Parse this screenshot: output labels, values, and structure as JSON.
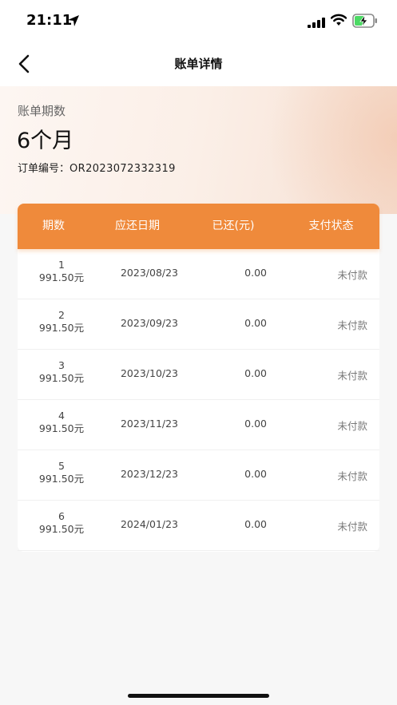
{
  "status_bar": {
    "time": "21:11"
  },
  "nav": {
    "title": "账单详情"
  },
  "summary": {
    "period_label": "账单期数",
    "period_value": "6个月",
    "order_label": "订单编号：",
    "order_number": "OR2023072332319"
  },
  "table": {
    "header_color": "#ef8a3b",
    "headers": [
      "期数",
      "应还日期",
      "已还(元)",
      "支付状态"
    ],
    "rows": [
      {
        "no": "1",
        "amount": "991.50元",
        "date": "2023/08/23",
        "paid": "0.00",
        "status": "未付款"
      },
      {
        "no": "2",
        "amount": "991.50元",
        "date": "2023/09/23",
        "paid": "0.00",
        "status": "未付款"
      },
      {
        "no": "3",
        "amount": "991.50元",
        "date": "2023/10/23",
        "paid": "0.00",
        "status": "未付款"
      },
      {
        "no": "4",
        "amount": "991.50元",
        "date": "2023/11/23",
        "paid": "0.00",
        "status": "未付款"
      },
      {
        "no": "5",
        "amount": "991.50元",
        "date": "2023/12/23",
        "paid": "0.00",
        "status": "未付款"
      },
      {
        "no": "6",
        "amount": "991.50元",
        "date": "2024/01/23",
        "paid": "0.00",
        "status": "未付款"
      }
    ]
  },
  "icons": {
    "location": "location-arrow-icon",
    "signal": "cellular-signal-icon",
    "wifi": "wifi-icon",
    "battery": "battery-charging-icon",
    "back": "chevron-left-icon"
  }
}
